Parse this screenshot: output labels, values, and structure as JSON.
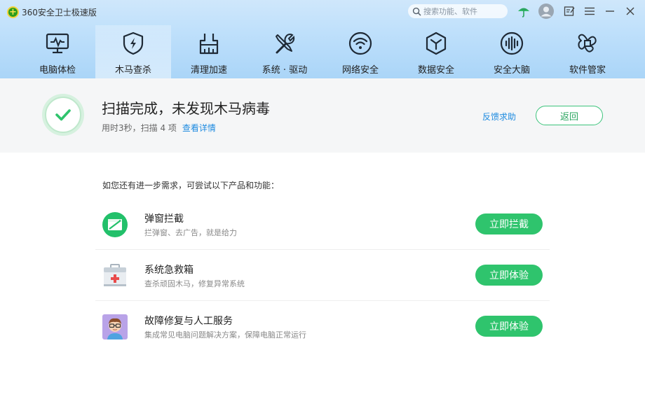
{
  "app": {
    "title": "360安全卫士极速版"
  },
  "search": {
    "placeholder": "搜索功能、软件"
  },
  "toolbar_icons": [
    "umbrella-icon",
    "avatar",
    "feedback-icon",
    "menu-icon",
    "minimize-icon",
    "close-icon"
  ],
  "tabs": [
    {
      "label": "电脑体检",
      "icon": "monitor-pulse-icon",
      "active": false
    },
    {
      "label": "木马查杀",
      "icon": "shield-bolt-icon",
      "active": true
    },
    {
      "label": "清理加速",
      "icon": "broom-icon",
      "active": false
    },
    {
      "label": "系统 · 驱动",
      "icon": "wrench-screwdriver-icon",
      "active": false
    },
    {
      "label": "网络安全",
      "icon": "wifi-icon",
      "active": false
    },
    {
      "label": "数据安全",
      "icon": "cube-icon",
      "active": false
    },
    {
      "label": "安全大脑",
      "icon": "brain-wave-icon",
      "active": false
    },
    {
      "label": "软件管家",
      "icon": "apps-icon",
      "active": false
    }
  ],
  "status": {
    "title": "扫描完成，未发现木马病毒",
    "subtitle": "用时3秒，扫描 4 项",
    "details_link": "查看详情",
    "feedback_link": "反馈求助",
    "back_button": "返回"
  },
  "recommend": {
    "intro": "如您还有进一步需求，可尝试以下产品和功能：",
    "items": [
      {
        "name": "弹窗拦截",
        "desc": "拦弹窗、去广告，就是给力",
        "button": "立即拦截",
        "icon": "popup-block-icon"
      },
      {
        "name": "系统急救箱",
        "desc": "查杀顽固木马，修复异常系统",
        "button": "立即体验",
        "icon": "first-aid-kit-icon"
      },
      {
        "name": "故障修复与人工服务",
        "desc": "集成常见电脑问题解决方案，保障电脑正常运行",
        "button": "立即体验",
        "icon": "support-engineer-icon"
      }
    ]
  },
  "colors": {
    "accent_green": "#2fc46d",
    "link_blue": "#1e8be0",
    "header_blue": "#bfe0fb"
  }
}
